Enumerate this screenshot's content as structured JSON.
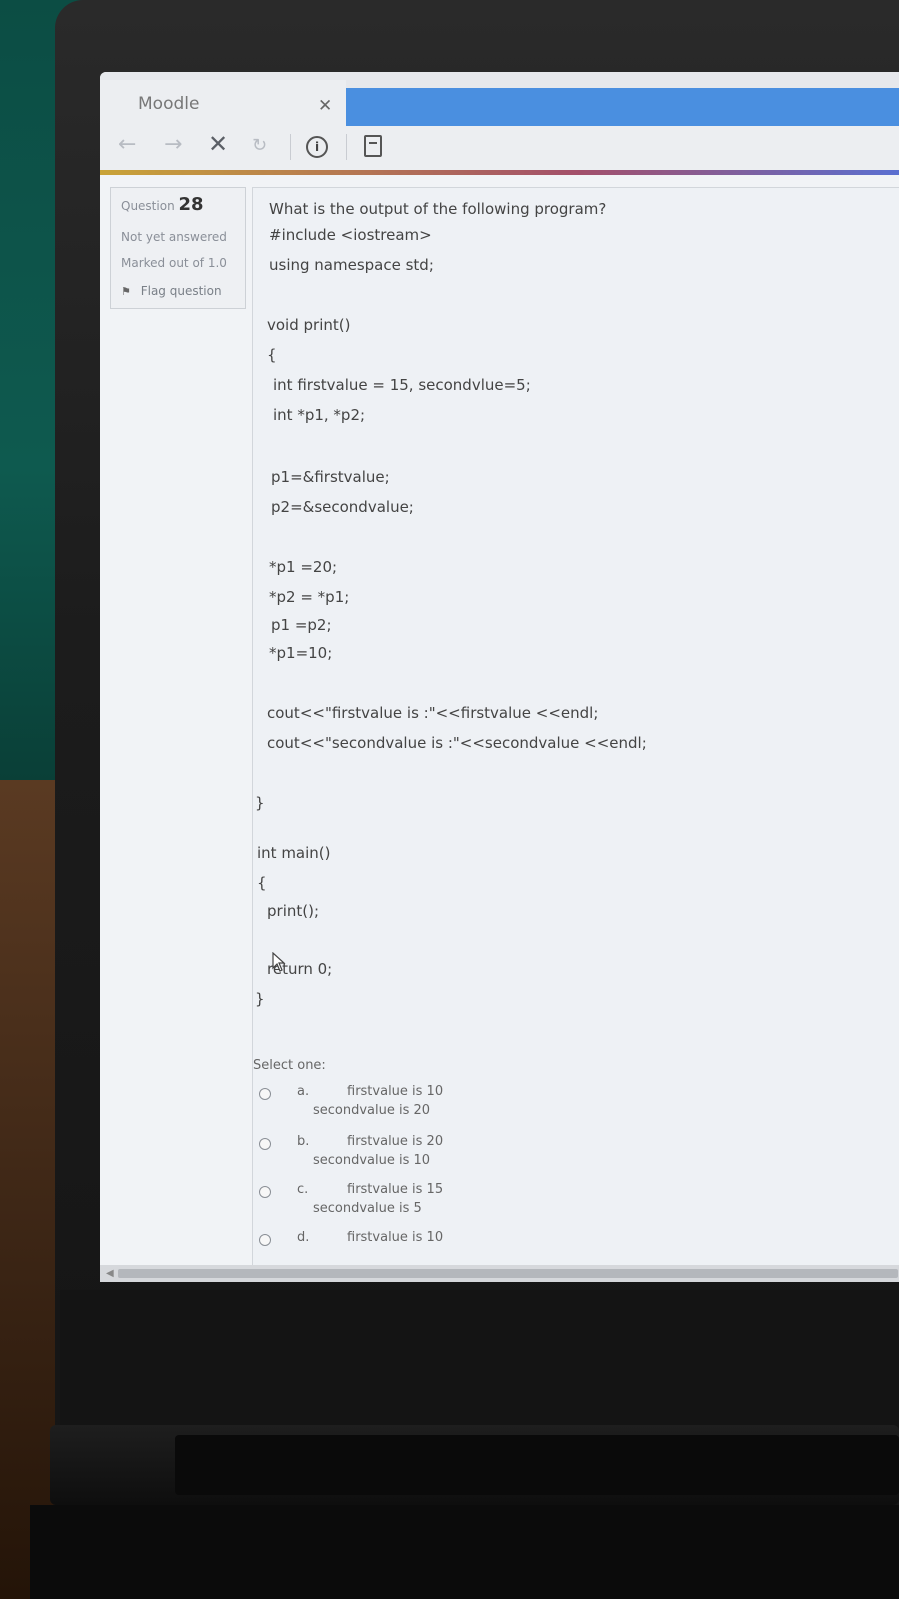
{
  "browser": {
    "tab_title": "Moodle",
    "tab_close_icon": "close-icon",
    "nav": {
      "back_icon": "back-icon",
      "forward_icon": "forward-icon",
      "stop_icon": "stop-icon",
      "reload_icon": "reload-icon",
      "info_icon": "info-icon",
      "reader_icon": "reader-icon"
    },
    "stop_glyph": "✕",
    "back_glyph": "←",
    "forward_glyph": "→",
    "reload_glyph": "↻",
    "info_glyph": "i",
    "accent_color": "#4a8fe0"
  },
  "question_info": {
    "label": "Question",
    "number": "28",
    "state": "Not yet answered",
    "grade": "Marked out of 1.0",
    "flag_label": "Flag question",
    "flag_glyph": "⚑"
  },
  "question": {
    "prompt": "What is the output of the following program?",
    "code": [
      "#include <iostream>",
      "using namespace std;",
      "void print()",
      "{",
      "int firstvalue = 15, secondvlue=5;",
      "int *p1, *p2;",
      "p1=&firstvalue;",
      "p2=&secondvalue;",
      "*p1 =20;",
      "*p2 = *p1;",
      "p1 =p2;",
      "*p1=10;",
      "cout<<\"firstvalue is :\"<<firstvalue <<endl;",
      "cout<<\"secondvalue is :\"<<secondvalue <<endl;",
      "}",
      "int main()",
      "{",
      "print();",
      "return 0;",
      "}"
    ],
    "select_label": "Select one:",
    "options": [
      {
        "letter": "a.",
        "line1": "firstvalue is 10",
        "line2": "secondvalue is 20"
      },
      {
        "letter": "b.",
        "line1": "firstvalue is 20",
        "line2": "secondvalue is 10"
      },
      {
        "letter": "c.",
        "line1": "firstvalue is 15",
        "line2": "secondvalue is 5"
      },
      {
        "letter": "d.",
        "line1": "firstvalue is 10",
        "line2": ""
      }
    ]
  }
}
